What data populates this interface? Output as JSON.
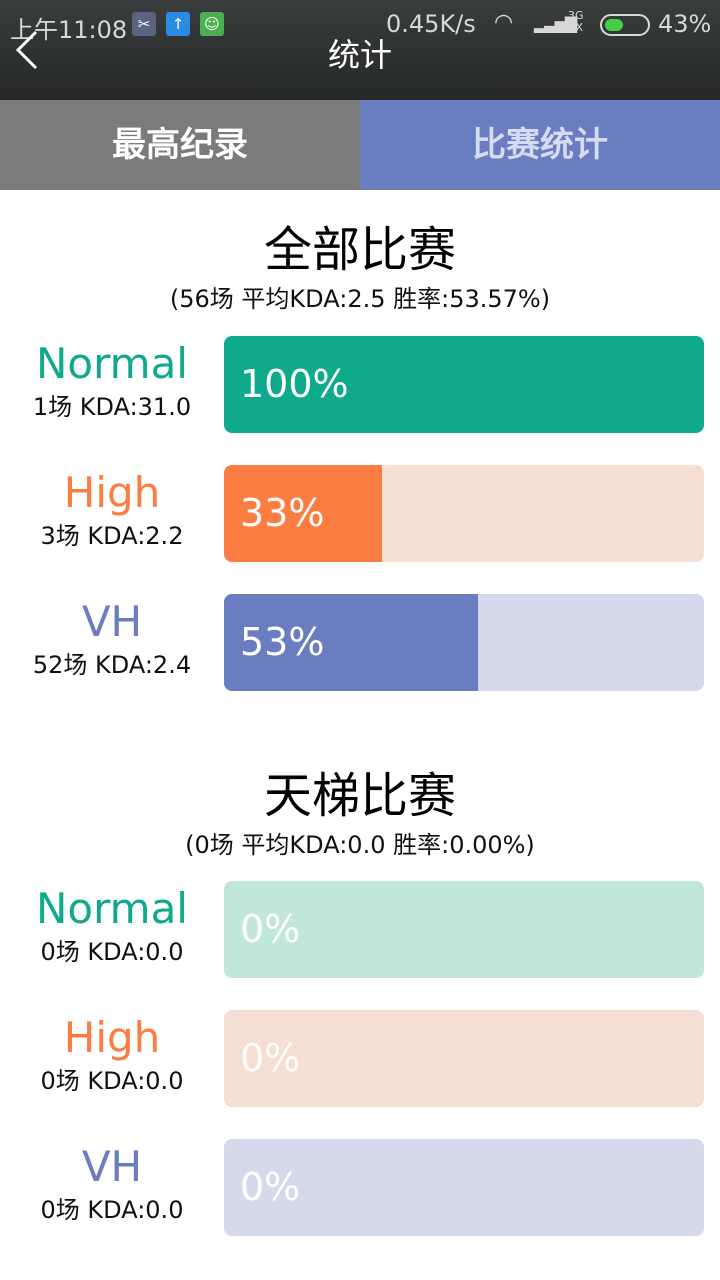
{
  "status": {
    "time": "上午11:08",
    "speed": "0.45K/s",
    "net_top": "3G",
    "net_bottom": "1X",
    "battery": "43%"
  },
  "header": {
    "title": "统计",
    "back_icon": "chevron-left-icon"
  },
  "tabs": [
    {
      "label": "最高纪录",
      "active": false
    },
    {
      "label": "比赛统计",
      "active": true
    }
  ],
  "colors": {
    "normal": "#0faa8c",
    "normal_bg": "#c1e6dc",
    "high": "#fb7d42",
    "high_bg": "#f5ded3",
    "vh": "#6a7dc1",
    "vh_bg": "#d4daeb",
    "tab_active": "#6a7dc1",
    "tab_inactive": "#7b7b7b"
  },
  "sections": [
    {
      "title": "全部比赛",
      "subtitle": "(56场 平均KDA:2.5 胜率:53.57%)",
      "rows": [
        {
          "name": "Normal",
          "meta": "1场 KDA:31.0",
          "pct_label": "100%",
          "fraction": 1.0
        },
        {
          "name": "High",
          "meta": "3场 KDA:2.2",
          "pct_label": "33%",
          "fraction": 0.33
        },
        {
          "name": "VH",
          "meta": "52场 KDA:2.4",
          "pct_label": "53%",
          "fraction": 0.53
        }
      ]
    },
    {
      "title": "天梯比赛",
      "subtitle": "(0场 平均KDA:0.0 胜率:0.00%)",
      "rows": [
        {
          "name": "Normal",
          "meta": "0场 KDA:0.0",
          "pct_label": "0%",
          "fraction": 0.0
        },
        {
          "name": "High",
          "meta": "0场 KDA:0.0",
          "pct_label": "0%",
          "fraction": 0.0
        },
        {
          "name": "VH",
          "meta": "0场 KDA:0.0",
          "pct_label": "0%",
          "fraction": 0.0
        }
      ]
    }
  ]
}
